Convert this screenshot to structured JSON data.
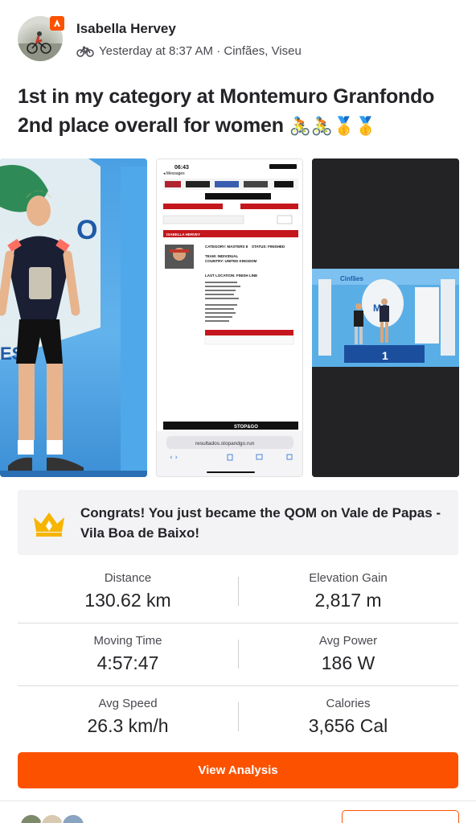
{
  "post": {
    "author": "Isabella Hervey",
    "meta": "Yesterday at 8:37 AM · Cinfães, Viseu",
    "title_line1": "1st in my category at Montemuro Granfondo",
    "title_line2": "2nd place overall for women",
    "title_emojis": "🚴🚴🥇🥇"
  },
  "photos": [
    {
      "icon": "podium-athlete-photo"
    },
    {
      "icon": "results-screenshot",
      "status_time": "06:43",
      "status_back": "◂ Messages",
      "results_name": "ISABELLA HERVEY",
      "category_label": "CATEGORY: MASTERS 8",
      "status_label": "STATUS: FINISHED",
      "team_label": "TEAM: INDIVIDUAL",
      "country_label": "COUNTRY: UNITED KINGDOM",
      "last_location": "LAST LOCATION: FINISH LINE",
      "brand": "STOP&GO",
      "url": "resultados.stopandgo.run"
    },
    {
      "icon": "podium-ceremony-photo"
    }
  ],
  "achievement": {
    "icon": "crown-icon",
    "text": "Congrats! You just became the QOM on Vale de Papas - Vila Boa de Baixo!"
  },
  "stats": [
    {
      "left_label": "Distance",
      "left_value": "130.62 km",
      "right_label": "Elevation Gain",
      "right_value": "2,817 m"
    },
    {
      "left_label": "Moving Time",
      "left_value": "4:57:47",
      "right_label": "Avg Power",
      "right_value": "186 W"
    },
    {
      "left_label": "Avg Speed",
      "left_value": "26.3 km/h",
      "right_label": "Calories",
      "right_value": "3,656 Cal"
    }
  ],
  "actions": {
    "view_analysis": "View Analysis"
  },
  "colors": {
    "brand_orange": "#fc5200",
    "text_primary": "#242428",
    "achievement_bg": "#f3f3f6",
    "crown_gold": "#f6b500"
  }
}
